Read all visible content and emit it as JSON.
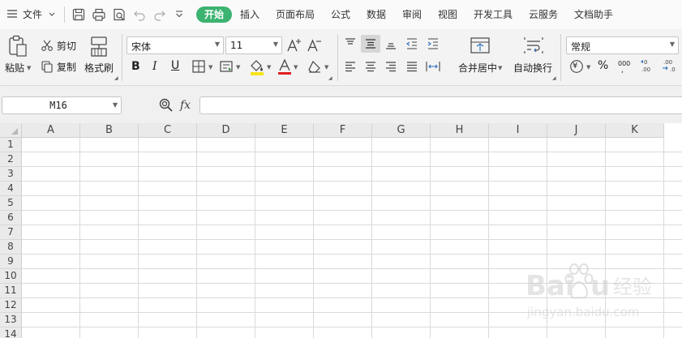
{
  "menu": {
    "file_label": "文件",
    "tabs": [
      "开始",
      "插入",
      "页面布局",
      "公式",
      "数据",
      "审阅",
      "视图",
      "开发工具",
      "云服务",
      "文档助手"
    ]
  },
  "ribbon": {
    "paste_label": "粘贴",
    "cut_label": "剪切",
    "copy_label": "复制",
    "format_painter_label": "格式刷",
    "font_name": "宋体",
    "font_size": "11",
    "merge_center_label": "合并居中",
    "wrap_text_label": "自动换行",
    "number_format": "常规",
    "percent_symbol": "%",
    "thousands_symbol": "000",
    "currency_symbol": "¥"
  },
  "formula_bar": {
    "name_box": "M16",
    "fx_label": "fx",
    "formula": ""
  },
  "sheet": {
    "columns": [
      "A",
      "B",
      "C",
      "D",
      "E",
      "F",
      "G",
      "H",
      "I",
      "J",
      "K"
    ],
    "rows": [
      "1",
      "2",
      "3",
      "4",
      "5",
      "6",
      "7",
      "8",
      "9",
      "10",
      "11",
      "12",
      "13",
      "14"
    ]
  },
  "watermark": {
    "brand": "Baidu经验",
    "url": "jingyan.baidu.com"
  },
  "colors": {
    "accent": "#3cb371",
    "font_color_bar": "#e02020",
    "fill_color_bar": "#f7e51a"
  }
}
